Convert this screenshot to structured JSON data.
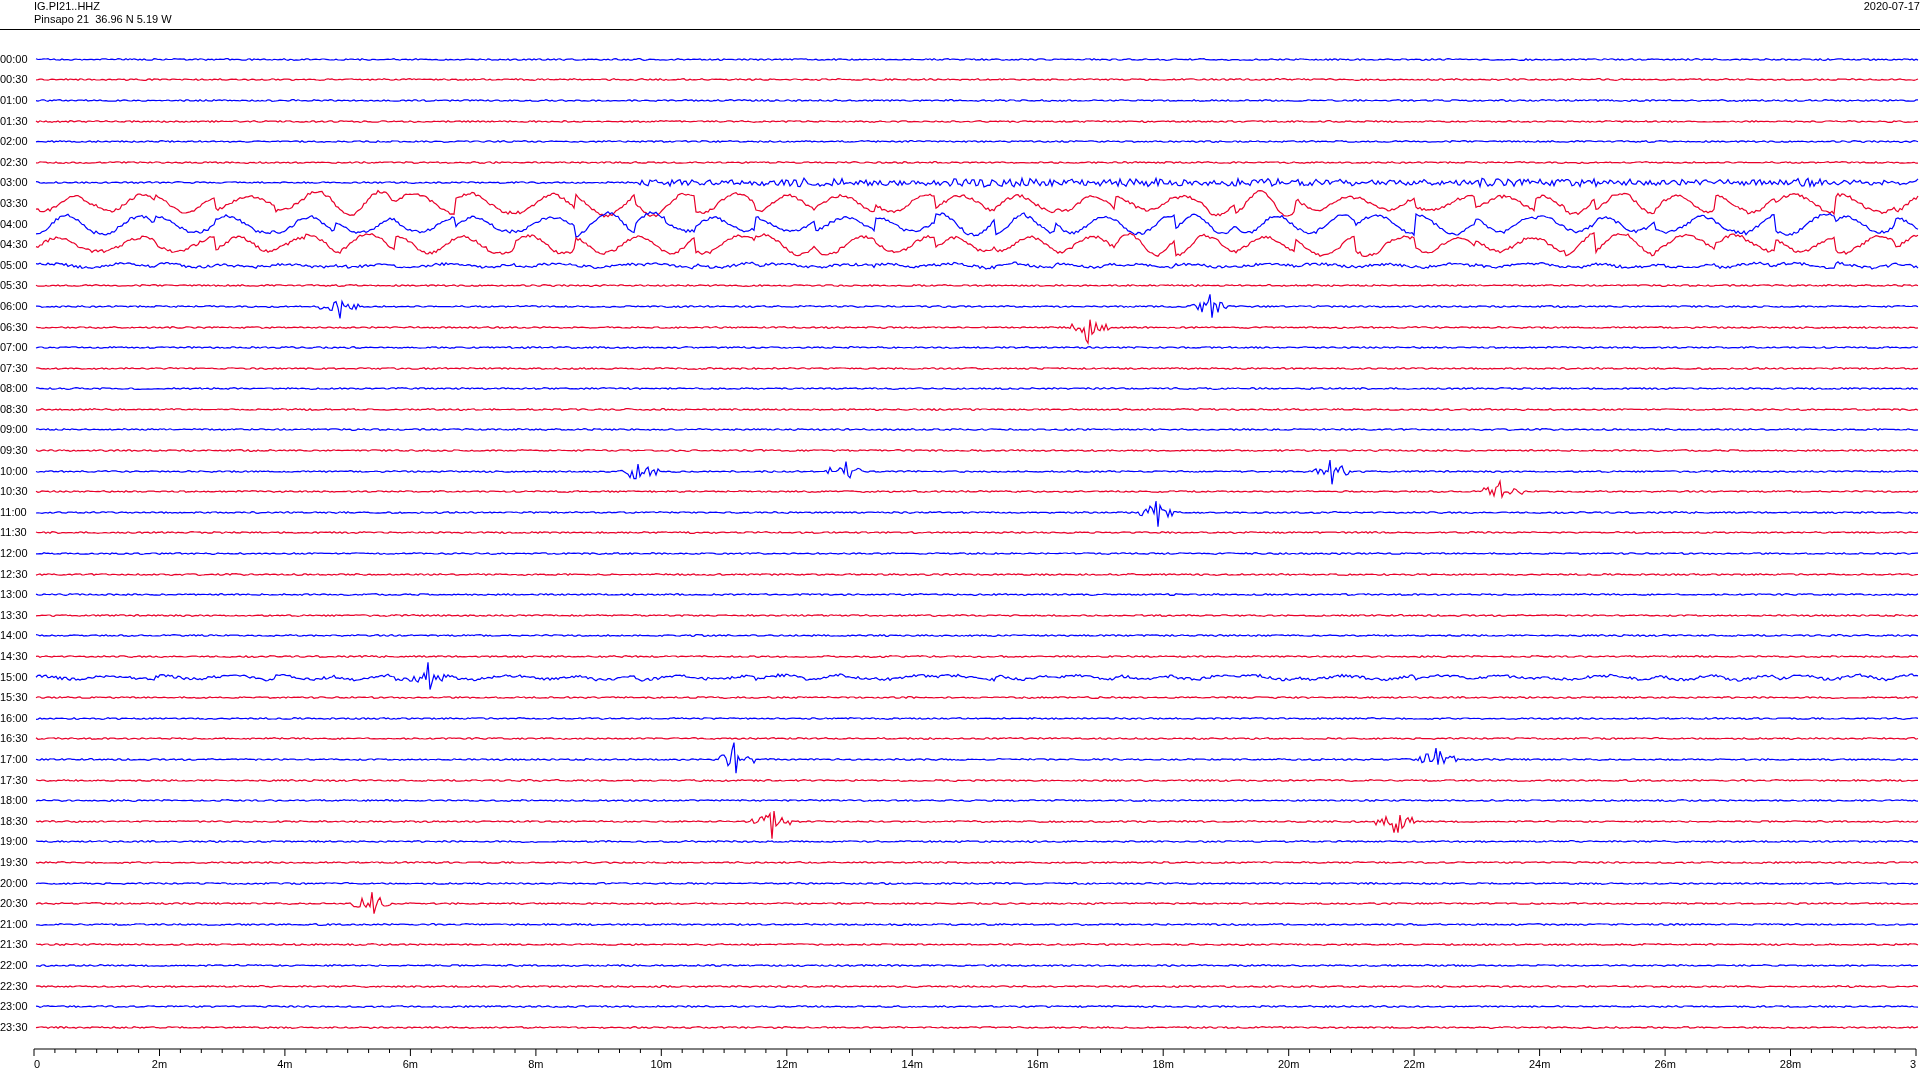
{
  "header": {
    "station": "IG.PI21..HHZ",
    "location": "Pinsapo 21  36.96 N 5.19 W",
    "date": "2020-07-17"
  },
  "traces": [
    {
      "time": "00:00",
      "color": "#0000ff",
      "kind": "quiet"
    },
    {
      "time": "00:30",
      "color": "#e8002a",
      "kind": "quiet"
    },
    {
      "time": "01:00",
      "color": "#0000ff",
      "kind": "quiet"
    },
    {
      "time": "01:30",
      "color": "#e8002a",
      "kind": "quiet"
    },
    {
      "time": "02:00",
      "color": "#0000ff",
      "kind": "quiet"
    },
    {
      "time": "02:30",
      "color": "#e8002a",
      "kind": "quiet"
    },
    {
      "time": "03:00",
      "color": "#0000ff",
      "kind": "onset"
    },
    {
      "time": "03:30",
      "color": "#e8002a",
      "kind": "storm"
    },
    {
      "time": "04:00",
      "color": "#0000ff",
      "kind": "storm"
    },
    {
      "time": "04:30",
      "color": "#e8002a",
      "kind": "storm"
    },
    {
      "time": "05:00",
      "color": "#0000ff",
      "kind": "noisy"
    },
    {
      "time": "05:30",
      "color": "#e8002a",
      "kind": "quiet"
    },
    {
      "time": "06:00",
      "color": "#0000ff",
      "kind": "quiet"
    },
    {
      "time": "06:30",
      "color": "#e8002a",
      "kind": "quiet"
    },
    {
      "time": "07:00",
      "color": "#0000ff",
      "kind": "quiet"
    },
    {
      "time": "07:30",
      "color": "#e8002a",
      "kind": "quiet"
    },
    {
      "time": "08:00",
      "color": "#0000ff",
      "kind": "quiet"
    },
    {
      "time": "08:30",
      "color": "#e8002a",
      "kind": "quiet"
    },
    {
      "time": "09:00",
      "color": "#0000ff",
      "kind": "quiet"
    },
    {
      "time": "09:30",
      "color": "#e8002a",
      "kind": "quiet"
    },
    {
      "time": "10:00",
      "color": "#0000ff",
      "kind": "quiet"
    },
    {
      "time": "10:30",
      "color": "#e8002a",
      "kind": "quiet"
    },
    {
      "time": "11:00",
      "color": "#0000ff",
      "kind": "quiet"
    },
    {
      "time": "11:30",
      "color": "#e8002a",
      "kind": "quiet"
    },
    {
      "time": "12:00",
      "color": "#0000ff",
      "kind": "quiet"
    },
    {
      "time": "12:30",
      "color": "#e8002a",
      "kind": "quiet"
    },
    {
      "time": "13:00",
      "color": "#0000ff",
      "kind": "quiet"
    },
    {
      "time": "13:30",
      "color": "#e8002a",
      "kind": "quiet"
    },
    {
      "time": "14:00",
      "color": "#0000ff",
      "kind": "quiet"
    },
    {
      "time": "14:30",
      "color": "#e8002a",
      "kind": "quiet"
    },
    {
      "time": "15:00",
      "color": "#0000ff",
      "kind": "noisy"
    },
    {
      "time": "15:30",
      "color": "#e8002a",
      "kind": "quiet"
    },
    {
      "time": "16:00",
      "color": "#0000ff",
      "kind": "quiet"
    },
    {
      "time": "16:30",
      "color": "#e8002a",
      "kind": "quiet"
    },
    {
      "time": "17:00",
      "color": "#0000ff",
      "kind": "quiet"
    },
    {
      "time": "17:30",
      "color": "#e8002a",
      "kind": "quiet"
    },
    {
      "time": "18:00",
      "color": "#0000ff",
      "kind": "quiet"
    },
    {
      "time": "18:30",
      "color": "#e8002a",
      "kind": "quiet"
    },
    {
      "time": "19:00",
      "color": "#0000ff",
      "kind": "quiet"
    },
    {
      "time": "19:30",
      "color": "#e8002a",
      "kind": "quiet"
    },
    {
      "time": "20:00",
      "color": "#0000ff",
      "kind": "quiet"
    },
    {
      "time": "20:30",
      "color": "#e8002a",
      "kind": "quiet"
    },
    {
      "time": "21:00",
      "color": "#0000ff",
      "kind": "quiet"
    },
    {
      "time": "21:30",
      "color": "#e8002a",
      "kind": "quiet"
    },
    {
      "time": "22:00",
      "color": "#0000ff",
      "kind": "quiet"
    },
    {
      "time": "22:30",
      "color": "#e8002a",
      "kind": "quiet"
    },
    {
      "time": "23:00",
      "color": "#0000ff",
      "kind": "quiet"
    },
    {
      "time": "23:30",
      "color": "#e8002a",
      "kind": "quiet"
    }
  ],
  "axis": {
    "labels": [
      "0",
      "2m",
      "4m",
      "6m",
      "8m",
      "10m",
      "12m",
      "14m",
      "16m",
      "18m",
      "20m",
      "22m",
      "24m",
      "26m",
      "28m",
      "3"
    ]
  }
}
